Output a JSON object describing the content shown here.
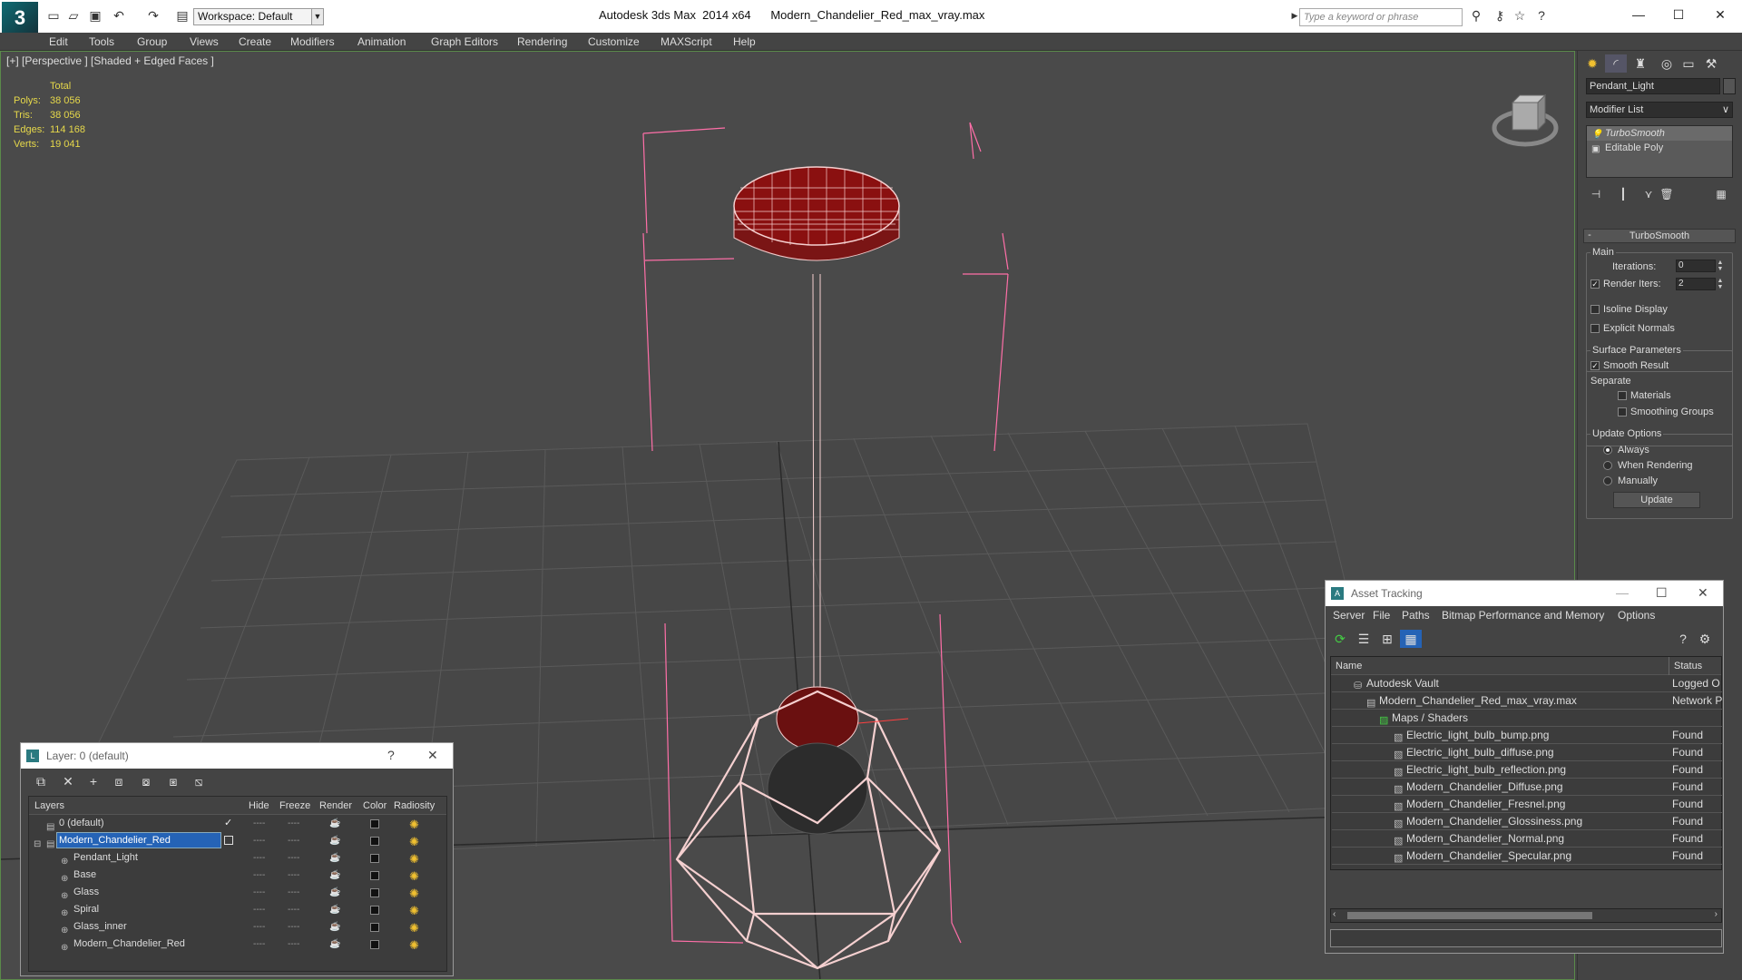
{
  "titlebar": {
    "workspace": "Workspace: Default",
    "title": "Autodesk 3ds Max  2014 x64      Modern_Chandelier_Red_max_vray.max",
    "search_placeholder": "Type a keyword or phrase"
  },
  "menu": [
    "Edit",
    "Tools",
    "Group",
    "Views",
    "Create",
    "Modifiers",
    "Animation",
    "Graph Editors",
    "Rendering",
    "Customize",
    "MAXScript",
    "Help"
  ],
  "viewport": {
    "label": "[+] [Perspective ] [Shaded + Edged Faces ]",
    "stats": {
      "header": "Total",
      "rows": [
        {
          "label": "Polys:",
          "value": "38 056"
        },
        {
          "label": "Tris:",
          "value": "38 056"
        },
        {
          "label": "Edges:",
          "value": "114 168"
        },
        {
          "label": "Verts:",
          "value": "19 041"
        }
      ]
    }
  },
  "command_panel": {
    "object_name": "Pendant_Light",
    "modifier_list": "Modifier List",
    "stack": [
      "TurboSmooth",
      "Editable Poly"
    ],
    "rollout": "TurboSmooth",
    "main": {
      "title": "Main",
      "iterations_label": "Iterations:",
      "iterations": "0",
      "render_iters_label": "Render Iters:",
      "render_iters": "2",
      "render_iters_checked": "true",
      "isoline": "Isoline Display",
      "explicit": "Explicit Normals"
    },
    "surface": {
      "title": "Surface Parameters",
      "smooth": "Smooth Result",
      "separate": "Separate",
      "materials": "Materials",
      "smoothing_groups": "Smoothing Groups"
    },
    "update": {
      "title": "Update Options",
      "always": "Always",
      "when_rendering": "When Rendering",
      "manually": "Manually",
      "button": "Update"
    }
  },
  "layer_window": {
    "title": "Layer: 0 (default)",
    "help": "?",
    "columns": [
      "Layers",
      "Hide",
      "Freeze",
      "Render",
      "Color",
      "Radiosity"
    ],
    "rows": [
      {
        "name": "0 (default)",
        "indent": 0
      },
      {
        "name": "Modern_Chandelier_Red",
        "indent": 0,
        "selected": true
      },
      {
        "name": "Pendant_Light",
        "indent": 1
      },
      {
        "name": "Base",
        "indent": 1
      },
      {
        "name": "Glass",
        "indent": 1
      },
      {
        "name": "Spiral",
        "indent": 1
      },
      {
        "name": "Glass_inner",
        "indent": 1
      },
      {
        "name": "Modern_Chandelier_Red",
        "indent": 1
      }
    ]
  },
  "asset_window": {
    "title": "Asset Tracking",
    "menu": [
      "Server",
      "File",
      "Paths",
      "Bitmap Performance and Memory",
      "Options"
    ],
    "columns": [
      "Name",
      "Status"
    ],
    "rows": [
      {
        "name": "Autodesk Vault",
        "status": "Logged O",
        "indent": 1
      },
      {
        "name": "Modern_Chandelier_Red_max_vray.max",
        "status": "Network P",
        "indent": 2
      },
      {
        "name": "Maps / Shaders",
        "status": "",
        "indent": 3
      },
      {
        "name": "Electric_light_bulb_bump.png",
        "status": "Found",
        "indent": 4
      },
      {
        "name": "Electric_light_bulb_diffuse.png",
        "status": "Found",
        "indent": 4
      },
      {
        "name": "Electric_light_bulb_reflection.png",
        "status": "Found",
        "indent": 4
      },
      {
        "name": "Modern_Chandelier_Diffuse.png",
        "status": "Found",
        "indent": 4
      },
      {
        "name": "Modern_Chandelier_Fresnel.png",
        "status": "Found",
        "indent": 4
      },
      {
        "name": "Modern_Chandelier_Glossiness.png",
        "status": "Found",
        "indent": 4
      },
      {
        "name": "Modern_Chandelier_Normal.png",
        "status": "Found",
        "indent": 4
      },
      {
        "name": "Modern_Chandelier_Specular.png",
        "status": "Found",
        "indent": 4
      }
    ]
  }
}
